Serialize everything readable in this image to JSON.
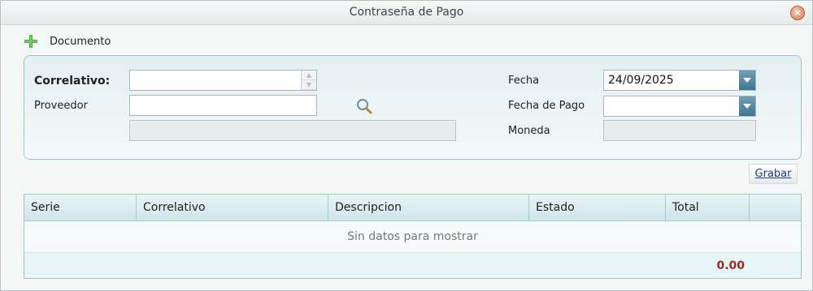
{
  "window": {
    "title": "Contraseña de Pago",
    "close_glyph": "×"
  },
  "toolbar": {
    "document_label": "Documento",
    "document_icon": "plus-icon"
  },
  "form": {
    "correlativo_label": "Correlativo:",
    "correlativo_value": "",
    "proveedor_label": "Proveedor",
    "proveedor_value": "",
    "proveedor_name_value": "",
    "fecha_label": "Fecha",
    "fecha_value": "24/09/2025",
    "fecha_pago_label": "Fecha de Pago",
    "fecha_pago_value": "",
    "moneda_label": "Moneda",
    "moneda_value": ""
  },
  "actions": {
    "save_label": "Grabar"
  },
  "grid": {
    "columns": [
      "Serie",
      "Correlativo",
      "Descripcion",
      "Estado",
      "Total"
    ],
    "empty_text": "Sin datos para mostrar",
    "total_value": "0.00"
  },
  "colors": {
    "accent": "#3f7696",
    "total": "#a1282a",
    "panel_border": "#9fc5cb"
  }
}
